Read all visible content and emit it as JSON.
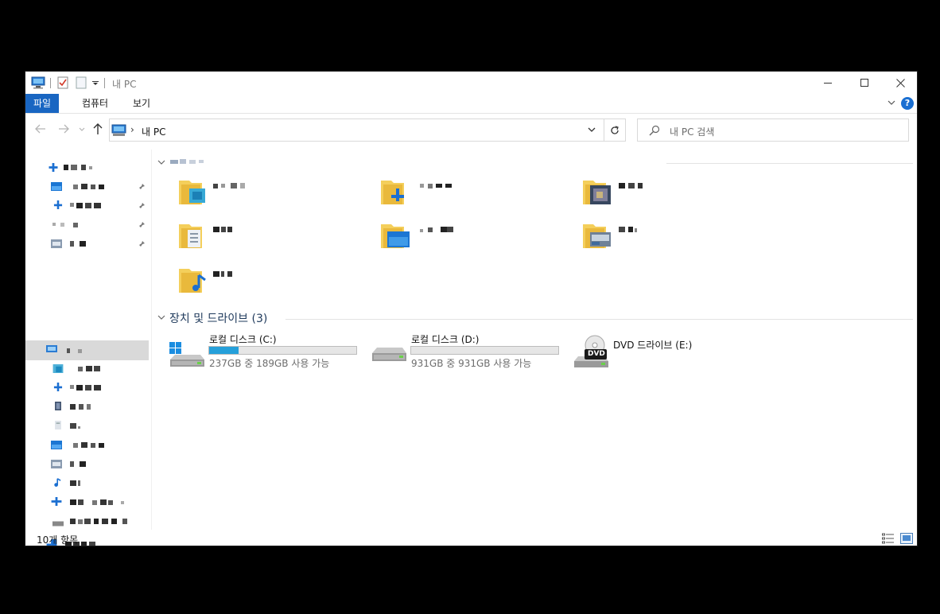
{
  "window": {
    "title": "내 PC",
    "controls": [
      "minimize-icon",
      "maximize-icon",
      "close-icon"
    ]
  },
  "ribbon": {
    "tabs": [
      {
        "label": "파일",
        "active": true
      },
      {
        "label": "컴퓨터",
        "active": false
      },
      {
        "label": "보기",
        "active": false
      }
    ],
    "help_label": "?"
  },
  "address": {
    "path_label": "내 PC",
    "separator": "›"
  },
  "search": {
    "placeholder": "내 PC 검색"
  },
  "content": {
    "devices_title": "장치 및 드라이브 (3)",
    "drives": [
      {
        "name": "로컬 디스크 (C:)",
        "free_text": "237GB 중 189GB 사용 가능",
        "used_fraction": 0.2
      },
      {
        "name": "로컬 디스크 (D:)",
        "free_text": "931GB 중 931GB 사용 가능",
        "used_fraction": 0.0
      },
      {
        "name": "DVD 드라이브 (E:)",
        "badge": "DVD"
      }
    ]
  },
  "status": {
    "item_count": "10개 항목"
  },
  "colors": {
    "accent": "#1966c2",
    "drive_fill": "#26a0da",
    "section_title": "#1e395b"
  }
}
